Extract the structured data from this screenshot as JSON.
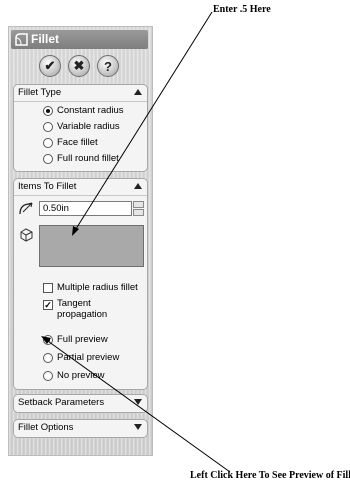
{
  "annotations": {
    "top": "Enter .5 Here",
    "bottom": "Left Click Here To See Preview of Fillet"
  },
  "property_manager": {
    "title": "Fillet",
    "title_icon": "fillet-feature-icon",
    "buttons": [
      {
        "name": "ok",
        "glyph": "✔"
      },
      {
        "name": "cancel",
        "glyph": "✖"
      },
      {
        "name": "help",
        "glyph": "?"
      }
    ]
  },
  "fillet_type": {
    "header": "Fillet Type",
    "options": [
      "Constant radius",
      "Variable radius",
      "Face fillet",
      "Full round fillet"
    ],
    "selected": "Constant radius"
  },
  "items_to_fillet": {
    "header": "Items To Fillet",
    "radius_value": "0.50in",
    "multiple_radius_label": "Multiple radius fillet",
    "multiple_radius_checked": false,
    "tangent_label_line1": "Tangent",
    "tangent_label_line2": "propagation",
    "tangent_checked": true,
    "preview_options": [
      "Full preview",
      "Partial preview",
      "No preview"
    ],
    "preview_selected": "Full preview"
  },
  "setback_parameters": {
    "header": "Setback Parameters"
  },
  "fillet_options": {
    "header": "Fillet Options"
  }
}
